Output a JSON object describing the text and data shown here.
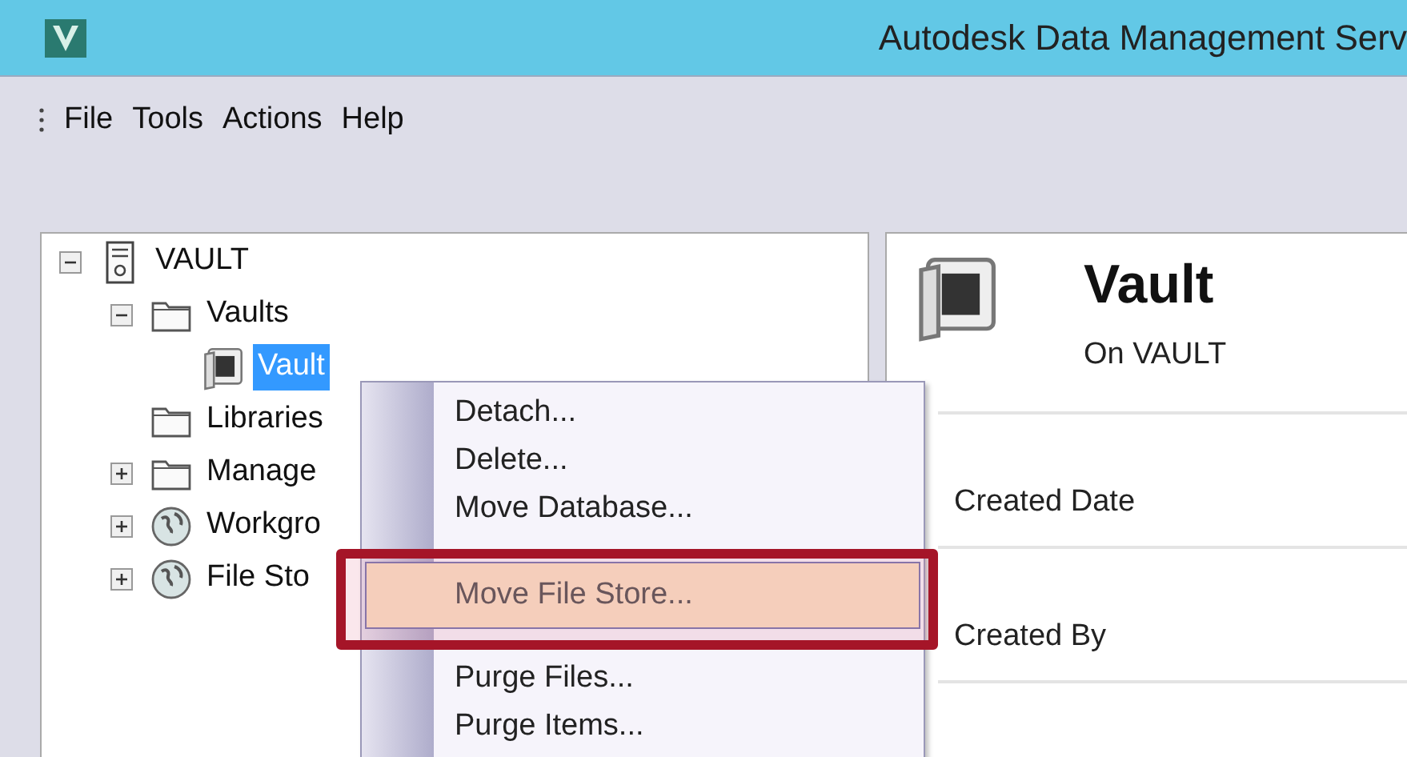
{
  "window": {
    "title": "Autodesk Data Management Serv"
  },
  "menu": [
    "File",
    "Tools",
    "Actions",
    "Help"
  ],
  "tree": [
    {
      "label": "VAULT",
      "kind": "server",
      "expanded": true,
      "selected": false,
      "children": [
        {
          "label": "Vaults",
          "kind": "folder",
          "expanded": true,
          "selected": false,
          "children": [
            {
              "label": "Vault",
              "kind": "vault",
              "selected": true
            }
          ]
        },
        {
          "label": "Libraries",
          "kind": "folder",
          "selected": false
        },
        {
          "label": "Manage",
          "kind": "folder",
          "expanded": false,
          "selected": false
        },
        {
          "label": "Workgro",
          "kind": "globe",
          "expanded": false,
          "selected": false
        },
        {
          "label": "File Sto",
          "kind": "globe",
          "expanded": false,
          "selected": false
        }
      ]
    }
  ],
  "details": {
    "title": "Vault",
    "subtitle": "On VAULT",
    "fields": [
      "Created Date",
      "Created By"
    ]
  },
  "context_menu": [
    {
      "label": "Detach...",
      "selected": false
    },
    {
      "label": "Delete...",
      "selected": false
    },
    {
      "label": "Move Database...",
      "selected": false
    },
    {
      "label": "Move File Store...",
      "selected": true
    },
    {
      "label": "Purge Files...",
      "selected": false
    },
    {
      "label": "Purge Items...",
      "selected": false
    }
  ]
}
